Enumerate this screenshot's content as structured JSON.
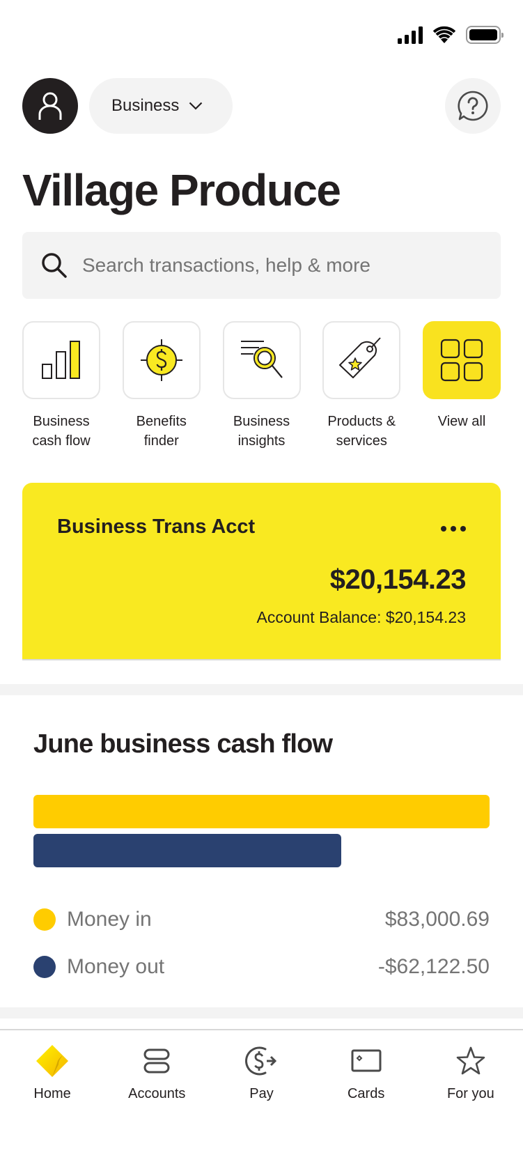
{
  "status_bar": {
    "signal_icon": "cellular-signal-icon",
    "wifi_icon": "wifi-icon",
    "battery_icon": "battery-icon"
  },
  "header": {
    "avatar_icon": "person-icon",
    "profile_switcher": {
      "label": "Business",
      "icon": "chevron-down-icon"
    },
    "help_icon": "help-chat-icon"
  },
  "page_title": "Village Produce",
  "search": {
    "placeholder": "Search transactions, help & more",
    "icon": "search-icon"
  },
  "quick_actions": [
    {
      "label": "Business\ncash flow",
      "icon": "bar-chart-icon"
    },
    {
      "label": "Benefits\nfinder",
      "icon": "dollar-target-icon"
    },
    {
      "label": "Business\ninsights",
      "icon": "magnifier-insights-icon"
    },
    {
      "label": "Products &\nservices",
      "icon": "price-tag-star-icon"
    },
    {
      "label": "View all",
      "icon": "grid-icon"
    }
  ],
  "account_card": {
    "name": "Business Trans Acct",
    "balance": "$20,154.23",
    "balance_line": "Account Balance: $20,154.23",
    "more_icon": "more-horizontal-icon"
  },
  "cash_flow": {
    "title": "June business cash flow"
  },
  "chart_data": {
    "type": "bar",
    "orientation": "horizontal",
    "title": "June business cash flow",
    "categories": [
      "Money in",
      "Money out"
    ],
    "values": [
      83000.69,
      -62122.5
    ],
    "display_values": [
      "$83,000.69",
      "-$62,122.50"
    ],
    "bar_fill_fraction": [
      1.0,
      0.675
    ],
    "colors": [
      "#ffcc00",
      "#2a4170"
    ],
    "legend": "bottom"
  },
  "bottom_nav": [
    {
      "label": "Home",
      "icon": "home-diamond-icon",
      "active": true
    },
    {
      "label": "Accounts",
      "icon": "accounts-icon",
      "active": false
    },
    {
      "label": "Pay",
      "icon": "pay-icon",
      "active": false
    },
    {
      "label": "Cards",
      "icon": "card-icon",
      "active": false
    },
    {
      "label": "For you",
      "icon": "star-icon",
      "active": false
    }
  ],
  "colors": {
    "brand_yellow": "#f9e921",
    "money_in": "#ffcc00",
    "money_out": "#2a4170",
    "text_dark": "#231f20",
    "text_muted": "#747474"
  }
}
